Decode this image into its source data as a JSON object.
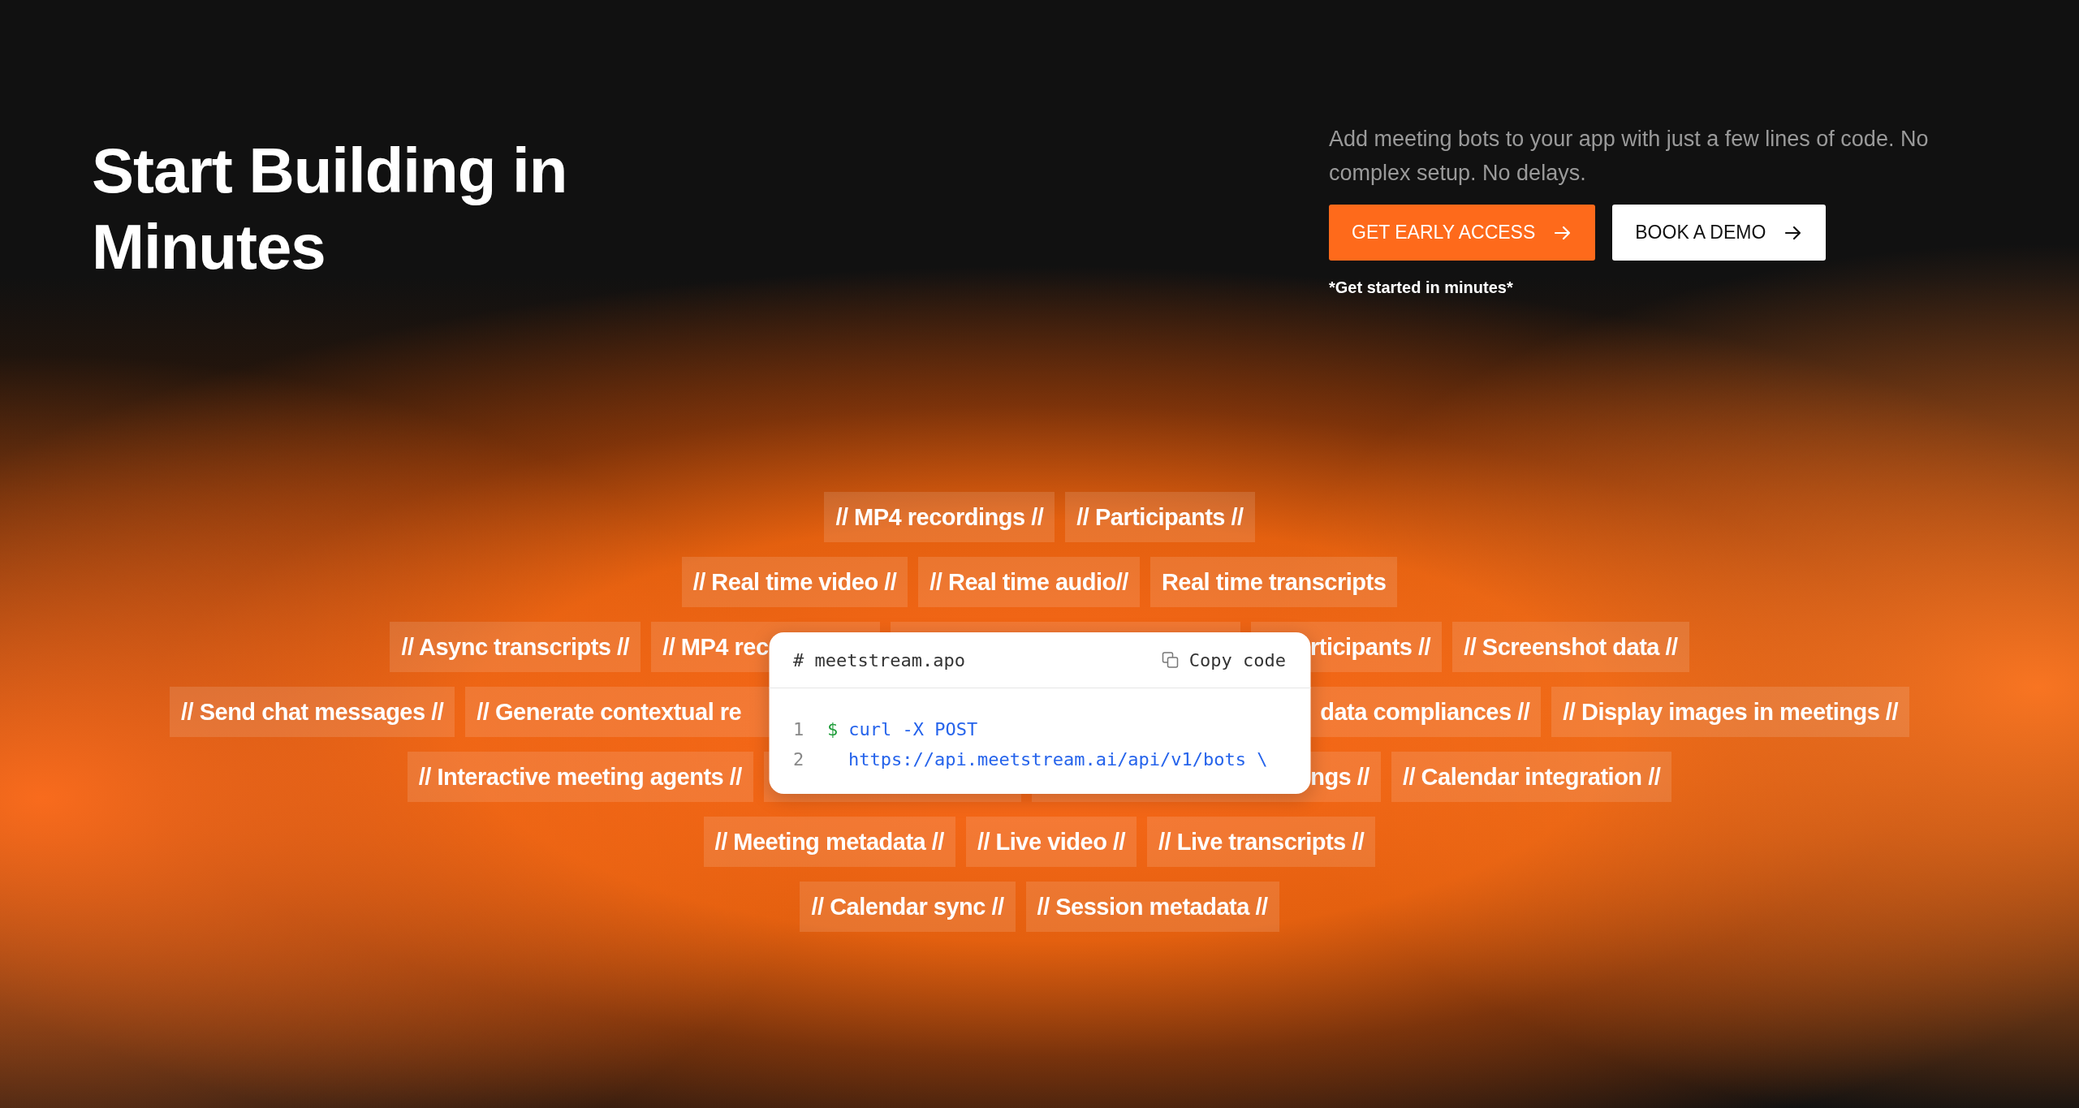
{
  "hero": {
    "title": "Start Building in Minutes",
    "description": "Add meeting bots to your app with just a few lines of code. No complex setup. No delays.",
    "buttons": [
      {
        "label": "GET EARLY ACCESS",
        "kind": "primary"
      },
      {
        "label": "BOOK A DEMO",
        "kind": "secondary"
      }
    ],
    "note": "*Get started in minutes*"
  },
  "feature_rows": [
    [
      {
        "label": "// MP4 recordings //",
        "kind": "full"
      },
      {
        "label": "// Participants  //",
        "kind": "full"
      }
    ],
    [
      {
        "label": "// Real time video //",
        "kind": "full"
      },
      {
        "label": "// Real time audio//",
        "kind": "full"
      },
      {
        "label": "Real time transcripts",
        "kind": "full"
      }
    ],
    [
      {
        "label": "// Async  transcripts //",
        "kind": "full"
      },
      {
        "label": "// MP4 rec",
        "kind": "cut-end"
      },
      {
        "kind": "hidden"
      },
      {
        "label": "rticipants //",
        "kind": "cut-start"
      },
      {
        "label": "// Screenshot data //",
        "kind": "full"
      }
    ],
    [
      {
        "label": "// Send chat messages //",
        "kind": "full"
      },
      {
        "label": "// Generate contextual re",
        "kind": "cut-end"
      },
      {
        "label": "data compliances //",
        "kind": "cut-start"
      },
      {
        "label": "// Display images in meetings //",
        "kind": "full"
      }
    ],
    [
      {
        "label": "// Interactive meeting agents //",
        "kind": "full"
      },
      {
        "kind": "hidden"
      },
      {
        "label": "ngs //",
        "kind": "cut-start"
      },
      {
        "label": "// Calendar integration //",
        "kind": "full"
      }
    ],
    [
      {
        "label": "// Meeting metadata //",
        "kind": "full"
      },
      {
        "label": "// Live video //",
        "kind": "full"
      },
      {
        "label": "// Live transcripts //",
        "kind": "full"
      }
    ],
    [
      {
        "label": "// Calendar sync //",
        "kind": "full"
      },
      {
        "label": "// Session metadata //",
        "kind": "full"
      }
    ]
  ],
  "code_card": {
    "filename": "# meetstream.apo",
    "copy_label": "Copy code",
    "lines": [
      {
        "number": "1",
        "prompt": "$",
        "text": "curl -X POST"
      },
      {
        "number": "2",
        "text": "https://api.meetstream.ai/api/v1/bots \\"
      }
    ]
  }
}
